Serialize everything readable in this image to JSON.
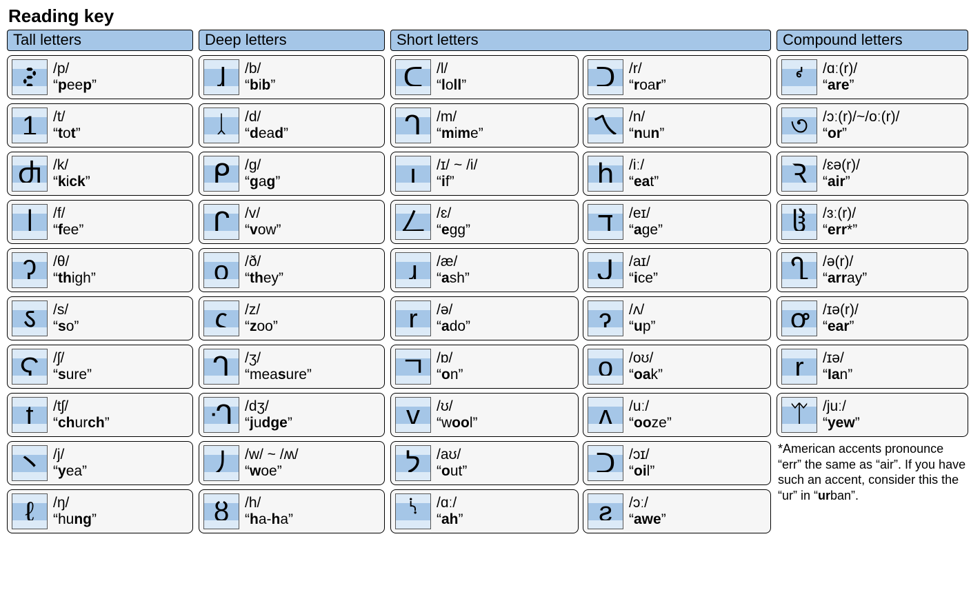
{
  "title": "Reading key",
  "footnote_html": "*American accents pronounce “err” the same as “air”. If you have such an accent, consider this the “ur” in “<b>ur</b>ban”.",
  "columns": {
    "tall": {
      "header": "Tall letters"
    },
    "deep": {
      "header": "Deep letters"
    },
    "short": {
      "header": "Short letters"
    },
    "compound": {
      "header": "Compound letters"
    }
  },
  "tall": [
    {
      "glyph": "🯲",
      "ipa": "/p/",
      "ex": "<b>p</b>ee<b>p</b>"
    },
    {
      "glyph": "1",
      "ipa": "/t/",
      "ex": "<b>t</b>o<b>t</b>"
    },
    {
      "glyph": "Ⴛ",
      "ipa": "/k/",
      "ex": "<b>k</b>i<b>ck</b>"
    },
    {
      "glyph": "亅",
      "ipa": "/f/",
      "ex": "<b>f</b>ee"
    },
    {
      "glyph": "ʔ",
      "ipa": "/θ/",
      "ex": "<b>th</b>igh"
    },
    {
      "glyph": "ऽ",
      "ipa": "/s/",
      "ex": "<b>s</b>o"
    },
    {
      "glyph": "Ϛ",
      "ipa": "/ʃ/",
      "ex": "<b>s</b>ure"
    },
    {
      "glyph": "ʈ",
      "ipa": "/tʃ/",
      "ex": "<b>ch</b>ur<b>ch</b>"
    },
    {
      "glyph": "丶",
      "ipa": "/j/",
      "ex": "<b>y</b>ea"
    },
    {
      "glyph": "ℓ",
      "ipa": "/ŋ/",
      "ex": "hu<b>ng</b>"
    }
  ],
  "deep": [
    {
      "glyph": "ɺ",
      "ipa": "/b/",
      "ex": "<b>b</b>i<b>b</b>"
    },
    {
      "glyph": "ᛸ",
      "ipa": "/d/",
      "ex": "<b>d</b>ea<b>d</b>"
    },
    {
      "glyph": "ᑭ",
      "ipa": "/g/",
      "ex": "<b>g</b>a<b>g</b>"
    },
    {
      "glyph": "ᒋ",
      "ipa": "/v/",
      "ex": "<b>v</b>ow"
    },
    {
      "glyph": "ϙ",
      "ipa": "/ð/",
      "ex": "<b>th</b>ey"
    },
    {
      "glyph": "ς",
      "ipa": "/z/",
      "ex": "<b>z</b>oo"
    },
    {
      "glyph": "ᒉ",
      "ipa": "/ʒ/",
      "ex": "mea<b>s</b>ure"
    },
    {
      "glyph": "ᒒ",
      "ipa": "/dʒ/",
      "ex": "<b>j</b>u<b>dge</b>"
    },
    {
      "glyph": "丿",
      "ipa": "/w/ ~ /ʍ/",
      "ex": "<b>w</b>oe"
    },
    {
      "glyph": "ȣ",
      "ipa": "/h/",
      "ex": "<b>h</b>a-<b>h</b>a"
    }
  ],
  "short": [
    {
      "left": {
        "glyph": "ᑕ",
        "ipa": "/l/",
        "ex": "<b>l</b>o<b>ll</b>"
      },
      "right": {
        "glyph": "ᑐ",
        "ipa": "/r/",
        "ex": "<b>r</b>oa<b>r</b>"
      }
    },
    {
      "left": {
        "glyph": "ᒉ",
        "ipa": "/m/",
        "ex": "<b>m</b>i<b>m</b>e"
      },
      "right": {
        "glyph": "ㄟ",
        "ipa": "/n/",
        "ex": "<b>n</b>u<b>n</b>"
      }
    },
    {
      "left": {
        "glyph": "ı",
        "ipa": "/ɪ/ ~ /i/",
        "ex": "<b>i</b>f"
      },
      "right": {
        "glyph": "ꜧ",
        "ipa": "/iː/",
        "ex": "<b>ea</b>t"
      }
    },
    {
      "left": {
        "glyph": "ㄥ",
        "ipa": "/ɛ/",
        "ex": "<b>e</b>gg"
      },
      "right": {
        "glyph": "ד",
        "ipa": "/eɪ/",
        "ex": "<b>a</b>ge"
      }
    },
    {
      "left": {
        "glyph": "ɹ",
        "ipa": "/æ/",
        "ex": "<b>a</b>sh"
      },
      "right": {
        "glyph": "ᒍ",
        "ipa": "/aɪ/",
        "ex": "<b>i</b>ce"
      }
    },
    {
      "left": {
        "glyph": "ɼ",
        "ipa": "/ə/",
        "ex": "<b>a</b>do"
      },
      "right": {
        "glyph": "ɂ",
        "ipa": "/ʌ/",
        "ex": "<b>u</b>p"
      }
    },
    {
      "left": {
        "glyph": "ㄱ",
        "ipa": "/ɒ/",
        "ex": "<b>o</b>n"
      },
      "right": {
        "glyph": "o",
        "ipa": "/oʊ/",
        "ex": "<b>oa</b>k"
      }
    },
    {
      "left": {
        "glyph": "v",
        "ipa": "/ʊ/",
        "ex": "w<b>oo</b>l"
      },
      "right": {
        "glyph": "ʌ",
        "ipa": "/uː/",
        "ex": "<b>oo</b>ze"
      }
    },
    {
      "left": {
        "glyph": "ל",
        "ipa": "/aʊ/",
        "ex": "<b>o</b>ut"
      },
      "right": {
        "glyph": "ᑐ",
        "ipa": "/ɔɪ/",
        "ex": "<b>oi</b>l"
      }
    },
    {
      "left": {
        "glyph": "ᔋ",
        "ipa": "/ɑː/",
        "ex": "<b>ah</b>"
      },
      "right": {
        "glyph": "ƨ",
        "ipa": "/ɔː/",
        "ex": "<b>awe</b>"
      }
    }
  ],
  "compound": [
    {
      "glyph": "ᔊ",
      "ipa": "/ɑː(r)/",
      "ex": "<b>are</b>"
    },
    {
      "glyph": "৩",
      "ipa": "/ɔː(r)/~/oː(r)/",
      "ex": "<b>or</b>"
    },
    {
      "glyph": "Ꝛ",
      "ipa": "/ɛə(r)/",
      "ex": "<b>air</b>"
    },
    {
      "glyph": "ჱ",
      "ipa": "/ɜː(r)/",
      "ex": "<b>err</b>*"
    },
    {
      "glyph": "Ⴂ",
      "ipa": "/ə(r)/",
      "ex": "<b>arr</b>ay"
    },
    {
      "glyph": "ꝍ",
      "ipa": "/ɪə(r)/",
      "ex": "<b>ear</b>"
    },
    {
      "glyph": "ɼ",
      "ipa": "/ɪə/",
      "ex": "<b>Ia</b>n"
    },
    {
      "glyph": "ᛠ",
      "ipa": "/juː/",
      "ex": "<b>yew</b>"
    }
  ]
}
